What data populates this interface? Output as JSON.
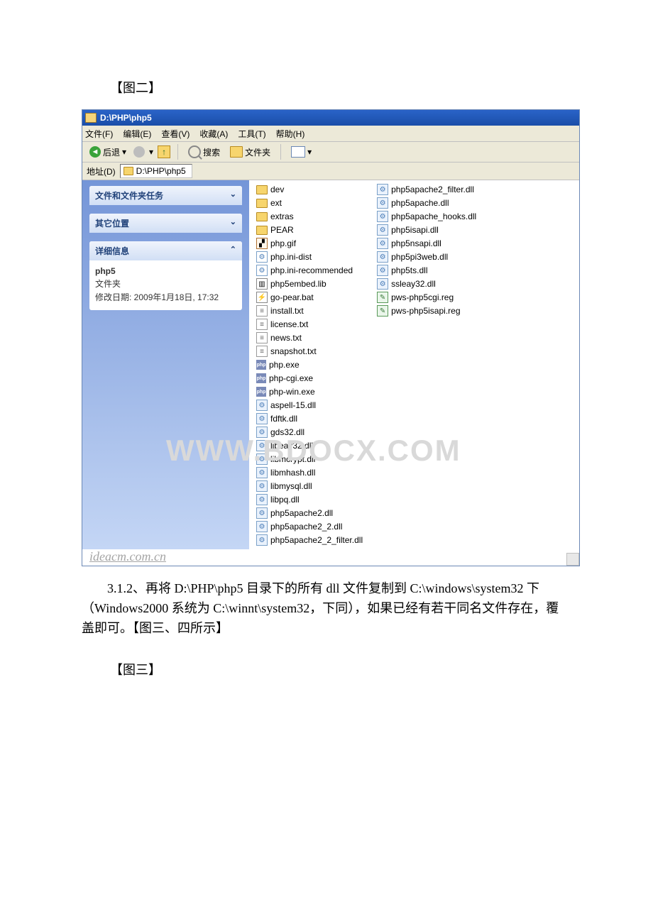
{
  "doc": {
    "caption_fig2": "【图二】",
    "caption_fig3": "【图三】",
    "paragraph": "3.1.2、再将 D:\\PHP\\php5 目录下的所有 dll 文件复制到 C:\\windows\\system32 下（Windows2000 系统为 C:\\winnt\\system32，下同），如果已经有若干同名文件存在，覆盖即可。【图三、四所示】"
  },
  "watermark_main": "WWW.BDOCX.COM",
  "watermark_footer": "ideacm.com.cn",
  "explorer": {
    "title": "D:\\PHP\\php5",
    "menu": {
      "file": "文件(F)",
      "edit": "编辑(E)",
      "view": "查看(V)",
      "favorites": "收藏(A)",
      "tools": "工具(T)",
      "help": "帮助(H)"
    },
    "toolbar": {
      "back": "后退",
      "search": "搜索",
      "folders": "文件夹"
    },
    "addressbar": {
      "label": "地址(D)",
      "path": "D:\\PHP\\php5"
    },
    "left": {
      "task_header_1": "文件和文件夹任务",
      "task_header_2": "其它位置",
      "task_header_3": "详细信息",
      "details_name": "php5",
      "details_type": "文件夹",
      "details_modified": "修改日期: 2009年1月18日, 17:32"
    },
    "files_col1": [
      {
        "icon": "folder",
        "name": "dev"
      },
      {
        "icon": "folder",
        "name": "ext"
      },
      {
        "icon": "folder",
        "name": "extras"
      },
      {
        "icon": "folder",
        "name": "PEAR"
      },
      {
        "icon": "img",
        "name": "php.gif"
      },
      {
        "icon": "gear",
        "name": "php.ini-dist"
      },
      {
        "icon": "gear",
        "name": "php.ini-recommended"
      },
      {
        "icon": "lib",
        "name": "php5embed.lib"
      },
      {
        "icon": "bat",
        "name": "go-pear.bat"
      },
      {
        "icon": "text",
        "name": "install.txt"
      },
      {
        "icon": "text",
        "name": "license.txt"
      },
      {
        "icon": "text",
        "name": "news.txt"
      },
      {
        "icon": "text",
        "name": "snapshot.txt"
      },
      {
        "icon": "php",
        "name": "php.exe"
      },
      {
        "icon": "php",
        "name": "php-cgi.exe"
      },
      {
        "icon": "php",
        "name": "php-win.exe"
      },
      {
        "icon": "dll",
        "name": "aspell-15.dll"
      },
      {
        "icon": "dll",
        "name": "fdftk.dll"
      },
      {
        "icon": "dll",
        "name": "gds32.dll"
      },
      {
        "icon": "dll",
        "name": "libeay32.dll"
      },
      {
        "icon": "dll",
        "name": "libmcrypt.dll"
      },
      {
        "icon": "dll",
        "name": "libmhash.dll"
      },
      {
        "icon": "dll",
        "name": "libmysql.dll"
      },
      {
        "icon": "dll",
        "name": "libpq.dll"
      },
      {
        "icon": "dll",
        "name": "php5apache2.dll"
      },
      {
        "icon": "dll",
        "name": "php5apache2_2.dll"
      },
      {
        "icon": "dll",
        "name": "php5apache2_2_filter.dll"
      }
    ],
    "files_col2": [
      {
        "icon": "dll",
        "name": "php5apache2_filter.dll"
      },
      {
        "icon": "dll",
        "name": "php5apache.dll"
      },
      {
        "icon": "dll",
        "name": "php5apache_hooks.dll"
      },
      {
        "icon": "dll",
        "name": "php5isapi.dll"
      },
      {
        "icon": "dll",
        "name": "php5nsapi.dll"
      },
      {
        "icon": "dll",
        "name": "php5pi3web.dll"
      },
      {
        "icon": "dll",
        "name": "php5ts.dll"
      },
      {
        "icon": "dll",
        "name": "ssleay32.dll"
      },
      {
        "icon": "reg",
        "name": "pws-php5cgi.reg"
      },
      {
        "icon": "reg",
        "name": "pws-php5isapi.reg"
      }
    ]
  }
}
